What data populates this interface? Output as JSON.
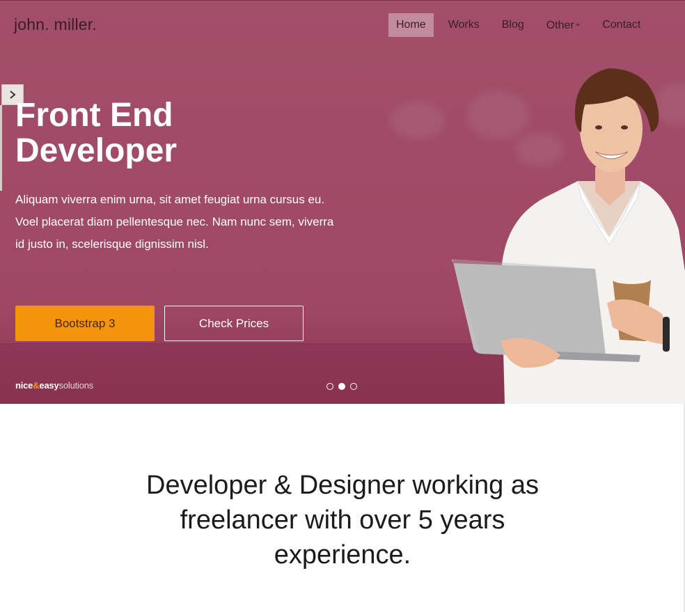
{
  "header": {
    "logo": "john. miller.",
    "nav": [
      {
        "label": "Home",
        "active": true
      },
      {
        "label": "Works"
      },
      {
        "label": "Blog"
      },
      {
        "label": "Other",
        "suffix": "+"
      },
      {
        "label": "Contact"
      }
    ]
  },
  "hero": {
    "title_line1": "Front End",
    "title_line2": "Developer",
    "text": "Aliquam viverra enim urna, sit amet feugiat urna cursus eu. Voel placerat diam pellentesque nec. Nam nunc sem, viverra id justo in, scelerisque dignissim nisl.",
    "primary_button": "Bootstrap 3",
    "secondary_button": "Check Prices",
    "brand": {
      "part1": "nice",
      "amp": "&",
      "part2": "easy",
      "part3": "solutions"
    },
    "slides": {
      "count": 3,
      "active_index": 1
    },
    "side_toggle_icon": "chevron-right-icon"
  },
  "intro": {
    "text": "Developer & Designer working as freelancer with over 5 years experience."
  },
  "colors": {
    "hero_bg": "#a24f6a",
    "accent": "#f4940b",
    "text_dark": "#3a1c28"
  }
}
